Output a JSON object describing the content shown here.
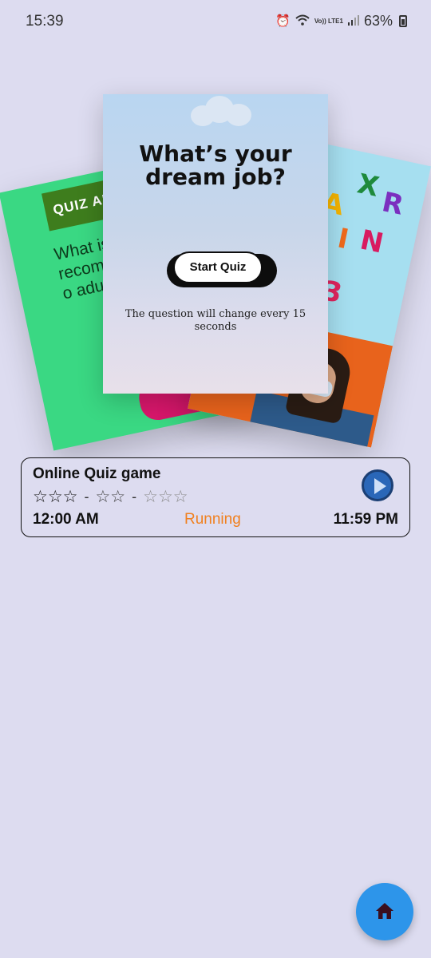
{
  "status_bar": {
    "time": "15:39",
    "network_label": "Vo)) LTE1",
    "battery": "63%"
  },
  "carousel": {
    "left_card": {
      "tag": "QUIZ AP",
      "question": "What is t recomm intake o adult?"
    },
    "center_card": {
      "title": "What’s your dream job?",
      "button_label": "Start Quiz",
      "note": "The question will change every 15 seconds"
    },
    "right_card": {
      "text": "IN"
    }
  },
  "game": {
    "title": "Online Quiz game",
    "stars_group_1": "☆☆☆",
    "stars_group_2": "☆☆",
    "stars_group_3": "☆☆☆",
    "start_time": "12:00 AM",
    "status": "Running",
    "end_time": "11:59 PM"
  },
  "colors": {
    "background": "#dddcf0",
    "status_running": "#f0801f",
    "fab": "#2d95ea"
  },
  "icons": {
    "play": "play-icon",
    "home": "home-icon",
    "alarm": "alarm-icon",
    "wifi": "wifi-icon",
    "signal": "signal-icon",
    "battery": "battery-icon"
  }
}
